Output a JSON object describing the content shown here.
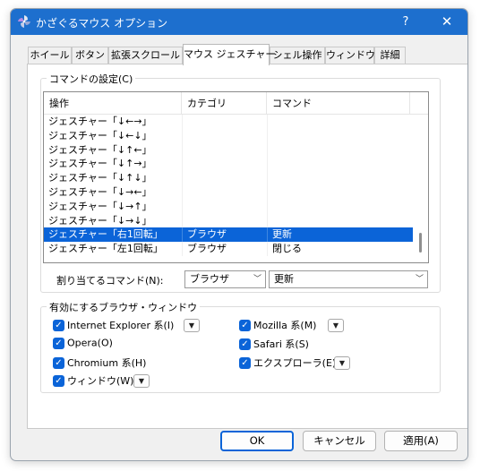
{
  "window": {
    "title": "かざぐるマウス オプション",
    "help_label": "?",
    "close_label": "✕"
  },
  "tabs": [
    {
      "label": "ホイール"
    },
    {
      "label": "ボタン"
    },
    {
      "label": "拡張スクロール"
    },
    {
      "label": "マウス ジェスチャー",
      "active": true
    },
    {
      "label": "シェル操作"
    },
    {
      "label": "ウィンドウ"
    },
    {
      "label": "詳細"
    }
  ],
  "commands": {
    "group_title": "コマンドの設定(C)",
    "columns": [
      "操作",
      "カテゴリ",
      "コマンド"
    ],
    "rows": [
      {
        "op": "ジェスチャー「↓←→」",
        "category": "",
        "command": ""
      },
      {
        "op": "ジェスチャー「↓←↓」",
        "category": "",
        "command": ""
      },
      {
        "op": "ジェスチャー「↓↑←」",
        "category": "",
        "command": ""
      },
      {
        "op": "ジェスチャー「↓↑→」",
        "category": "",
        "command": ""
      },
      {
        "op": "ジェスチャー「↓↑↓」",
        "category": "",
        "command": ""
      },
      {
        "op": "ジェスチャー「↓→←」",
        "category": "",
        "command": ""
      },
      {
        "op": "ジェスチャー「↓→↑」",
        "category": "",
        "command": ""
      },
      {
        "op": "ジェスチャー「↓→↓」",
        "category": "",
        "command": ""
      },
      {
        "op": "ジェスチャー「右1回転」",
        "category": "ブラウザ",
        "command": "更新",
        "selected": true
      },
      {
        "op": "ジェスチャー「左1回転」",
        "category": "ブラウザ",
        "command": "閉じる"
      }
    ],
    "assign_label": "割り当てるコマンド(N):",
    "category_value": "ブラウザ",
    "command_value": "更新"
  },
  "browsers": {
    "group_title": "有効にするブラウザ・ウィンドウ",
    "items": [
      {
        "label": "Internet Explorer 系(I)",
        "checked": true,
        "has_menu": true
      },
      {
        "label": "Mozilla 系(M)",
        "checked": true,
        "has_menu": true
      },
      {
        "label": "Opera(O)",
        "checked": true,
        "has_menu": false
      },
      {
        "label": "Safari 系(S)",
        "checked": true,
        "has_menu": false
      },
      {
        "label": "Chromium 系(H)",
        "checked": true,
        "has_menu": false
      },
      {
        "label": "エクスプローラ(E)",
        "checked": true,
        "has_menu": true
      },
      {
        "label": "ウィンドウ(W)",
        "checked": true,
        "has_menu": true
      }
    ]
  },
  "buttons": {
    "ok": "OK",
    "cancel": "キャンセル",
    "apply": "適用(A)"
  },
  "colors": {
    "accent": "#0b64d8",
    "titlebar": "#1d6fce",
    "window_bg": "#f0f0f0"
  },
  "icons": {
    "app": "pinwheel-icon",
    "checkbox": "check-icon",
    "dropdown": "chevron-down-icon"
  }
}
